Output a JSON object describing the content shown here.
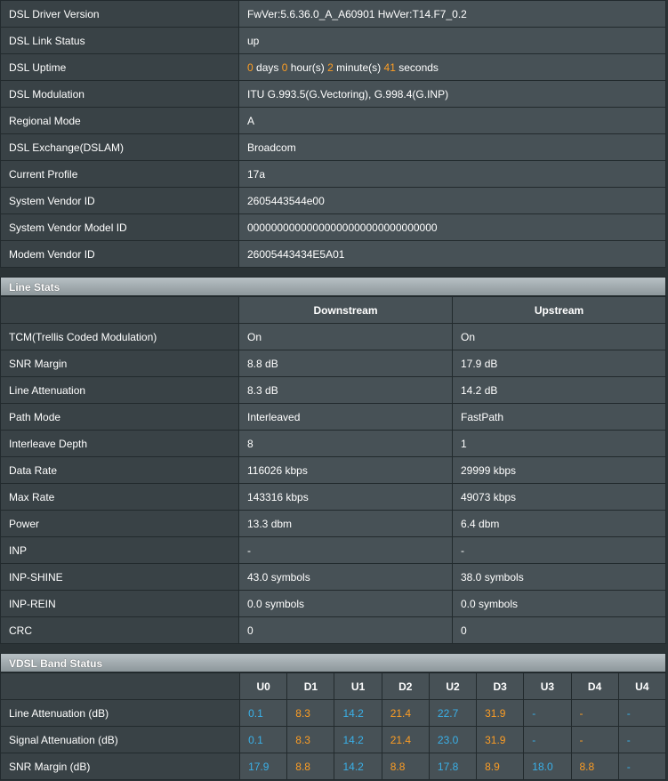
{
  "info_rows": [
    {
      "label": "DSL Driver Version",
      "value": "FwVer:5.6.36.0_A_A60901 HwVer:T14.F7_0.2"
    },
    {
      "label": "DSL Link Status",
      "value": "up"
    },
    {
      "label": "DSL Uptime",
      "value": ""
    },
    {
      "label": "DSL Modulation",
      "value": "ITU G.993.5(G.Vectoring), G.998.4(G.INP)"
    },
    {
      "label": "Regional Mode",
      "value": "A"
    },
    {
      "label": "DSL Exchange(DSLAM)",
      "value": "Broadcom"
    },
    {
      "label": "Current Profile",
      "value": "17a"
    },
    {
      "label": "System Vendor ID",
      "value": "2605443544e00"
    },
    {
      "label": "System Vendor Model ID",
      "value": "00000000000000000000000000000000"
    },
    {
      "label": "Modem Vendor ID",
      "value": "26005443434E5A01"
    }
  ],
  "uptime": {
    "days": "0",
    "days_label": "days",
    "hours": "0",
    "hours_label": "hour(s)",
    "minutes": "2",
    "minutes_label": "minute(s)",
    "seconds": "41",
    "seconds_label": "seconds"
  },
  "line_stats": {
    "title": "Line Stats",
    "col_downstream": "Downstream",
    "col_upstream": "Upstream",
    "rows": [
      {
        "label": "TCM(Trellis Coded Modulation)",
        "down": "On",
        "up": "On"
      },
      {
        "label": "SNR Margin",
        "down": "8.8 dB",
        "up": "17.9 dB"
      },
      {
        "label": "Line Attenuation",
        "down": "8.3 dB",
        "up": "14.2 dB"
      },
      {
        "label": "Path Mode",
        "down": "Interleaved",
        "up": "FastPath"
      },
      {
        "label": "Interleave Depth",
        "down": "8",
        "up": "1"
      },
      {
        "label": "Data Rate",
        "down": "116026 kbps",
        "up": "29999 kbps"
      },
      {
        "label": "Max Rate",
        "down": "143316 kbps",
        "up": "49073 kbps"
      },
      {
        "label": "Power",
        "down": "13.3 dbm",
        "up": "6.4 dbm"
      },
      {
        "label": "INP",
        "down": "-",
        "up": "-"
      },
      {
        "label": "INP-SHINE",
        "down": "43.0 symbols",
        "up": "38.0 symbols"
      },
      {
        "label": "INP-REIN",
        "down": "0.0 symbols",
        "up": "0.0 symbols"
      },
      {
        "label": "CRC",
        "down": "0",
        "up": "0"
      }
    ]
  },
  "band_status": {
    "title": "VDSL Band Status",
    "bands": [
      "U0",
      "D1",
      "U1",
      "D2",
      "U2",
      "D3",
      "U3",
      "D4",
      "U4"
    ],
    "upstream_color": "#3ab0e8",
    "downstream_color": "#fc9d24",
    "rows": [
      {
        "label": "Line Attenuation (dB)",
        "values": [
          "0.1",
          "8.3",
          "14.2",
          "21.4",
          "22.7",
          "31.9",
          "-",
          "-",
          "-"
        ]
      },
      {
        "label": "Signal Attenuation (dB)",
        "values": [
          "0.1",
          "8.3",
          "14.2",
          "21.4",
          "23.0",
          "31.9",
          "-",
          "-",
          "-"
        ]
      },
      {
        "label": "SNR Margin (dB)",
        "values": [
          "17.9",
          "8.8",
          "14.2",
          "8.8",
          "17.8",
          "8.9",
          "18.0",
          "8.8",
          "-"
        ]
      }
    ]
  }
}
